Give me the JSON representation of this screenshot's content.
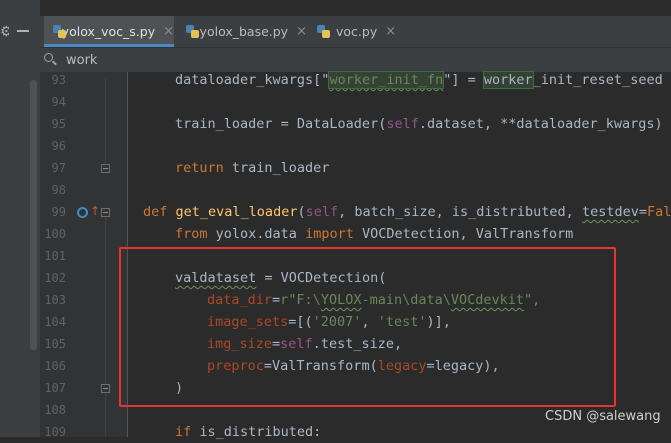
{
  "tabs": [
    {
      "label": "yolox_voc_s.py",
      "active": true
    },
    {
      "label": "yolox_base.py",
      "active": false
    },
    {
      "label": "voc.py",
      "active": false
    }
  ],
  "tab_close_glyph": "×",
  "search": {
    "value": "work"
  },
  "icons": {
    "settings": "gear-icon",
    "hide": "minus-icon",
    "search": "search-icon",
    "file": "python-file-icon",
    "override": "override-icon"
  },
  "colors": {
    "keyword": "#cc7832",
    "function": "#ffc66d",
    "string": "#6a8759",
    "self": "#94558d",
    "param": "#aa4926",
    "highlight_box": "#e5352f",
    "active_tab_accent": "#4a88c7"
  },
  "lines": {
    "n93": "93",
    "n94": "94",
    "n95": "95",
    "n96": "96",
    "n97": "97",
    "n98": "98",
    "n99": "99",
    "n100": "100",
    "n101": "101",
    "n102": "102",
    "n103": "103",
    "n104": "104",
    "n105": "105",
    "n106": "106",
    "n107": "107",
    "n108": "108",
    "n109": "109"
  },
  "code": {
    "l93": {
      "a": "dataloader_kwargs[\"",
      "b": "worker_init_fn",
      "c": "\"] = ",
      "d": "worker",
      "e": "_init_reset_seed"
    },
    "l95": {
      "a": "train_loader = DataLoader(",
      "b": "self",
      "c": ".dataset, **dataloader_kwargs)"
    },
    "l97": {
      "a": "return",
      "b": " train_loader"
    },
    "l99": {
      "a": "def",
      "b": " ",
      "c": "get_eval_loader",
      "d": "(",
      "e": "self",
      "f": ", batch_size, is_distributed, ",
      "g": "testdev",
      "h": "=",
      "i": "Fals"
    },
    "l100": {
      "a": "from",
      "b": " yolox.data ",
      "c": "import",
      "d": " VOCDetection, ValTransform"
    },
    "l102": {
      "a": "valdataset",
      "b": " = VOCDetection("
    },
    "l103": {
      "a": "data_dir",
      "b": "=",
      "c": "r\"F:\\",
      "d": "YOLOX",
      "e": "-main\\data\\",
      "f": "VOCdevkit",
      "g": "\","
    },
    "l104": {
      "a": "image_sets",
      "b": "=[(",
      "c": "'2007'",
      "d": ", ",
      "e": "'test'",
      "f": ")],"
    },
    "l105": {
      "a": "img_size",
      "b": "=",
      "c": "self",
      "d": ".test_size,"
    },
    "l106": {
      "a": "preproc",
      "b": "=ValTransform(",
      "c": "legacy",
      "d": "=legacy),"
    },
    "l107": {
      "a": ")"
    },
    "l109": {
      "a": "if",
      "b": " is_distributed:"
    }
  },
  "watermark": "CSDN @salewang"
}
